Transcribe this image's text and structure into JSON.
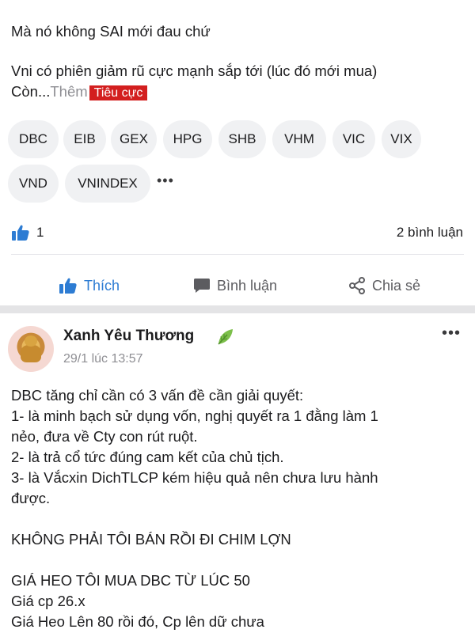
{
  "post1": {
    "text_line1": "Mà nó không SAI mới đau chứ",
    "text_line2": "Vni có phiên giảm rũ cực mạnh sắp tới (lúc đó mới mua)",
    "text_line3_prefix": "Còn...",
    "more_label": "Thêm",
    "sentiment_badge": "Tiêu cực",
    "tags": [
      "DBC",
      "EIB",
      "GEX",
      "HPG",
      "SHB",
      "VHM",
      "VIC",
      "VIX",
      "VND",
      "VNINDEX"
    ],
    "more_tags": "•••",
    "like_count": "1",
    "comment_count": "2 bình luận",
    "actions": {
      "like": "Thích",
      "comment": "Bình luận",
      "share": "Chia sẻ"
    }
  },
  "post2": {
    "author": "Xanh Yêu Thương",
    "timestamp": "29/1 lúc 13:57",
    "more_menu": "•••",
    "lines": [
      "DBC tăng chỉ cần có 3 vấn đề cần giải quyết:",
      "1- là minh bạch sử dụng vốn, nghị quyết ra 1 đằng làm 1",
      "nẻo, đưa về Cty con rút ruột.",
      "2- là trả cổ tức đúng cam kết của chủ tịch.",
      "3- là Vắcxin DichTLCP kém hiệu quả nên chưa lưu hành",
      "được.",
      "KHÔNG PHẢI TÔI BÁN RỒI ĐI CHIM LỢN",
      "GIÁ HEO TÔI MUA DBC TỪ LÚC 50",
      "Giá cp 26.x",
      "Giá Heo Lên 80 rồi đó, Cp lên dữ chưa"
    ]
  },
  "colors": {
    "accent": "#2d7cd3",
    "badge": "#d31f1f",
    "muted": "#8e8e93"
  }
}
